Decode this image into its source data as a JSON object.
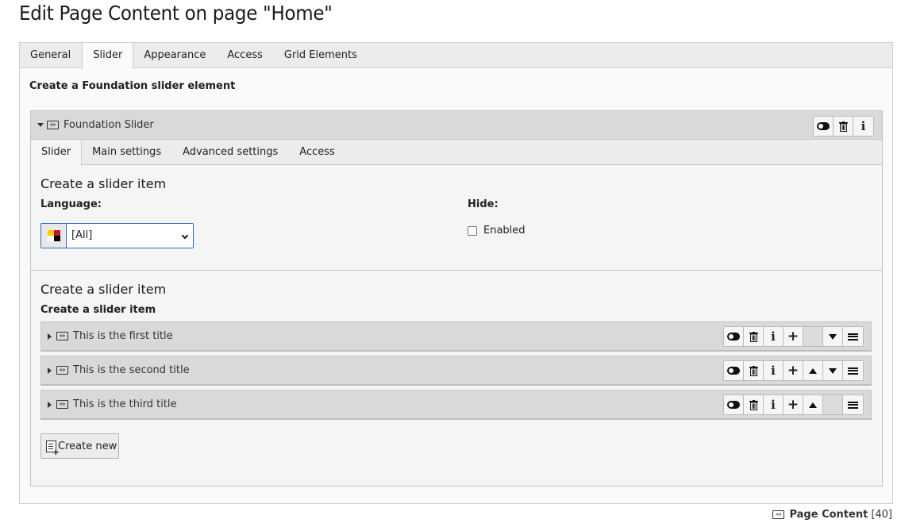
{
  "page_title": "Edit Page Content on page \"Home\"",
  "outer_tabs": [
    "General",
    "Slider",
    "Appearance",
    "Access",
    "Grid Elements"
  ],
  "outer_active_tab": "Slider",
  "section_title": "Create a Foundation slider element",
  "inline_element": {
    "label": "Foundation Slider",
    "tabs": [
      "Slider",
      "Main settings",
      "Advanced settings",
      "Access"
    ],
    "active_tab": "Slider"
  },
  "slider_section": {
    "heading": "Create a slider item",
    "language_label": "Language:",
    "language_value": "[All]",
    "hide_label": "Hide:",
    "enabled_label": "Enabled"
  },
  "items_section": {
    "heading": "Create a slider item",
    "subheading": "Create a slider item",
    "items": [
      {
        "title": "This is the first title"
      },
      {
        "title": "This is the second title"
      },
      {
        "title": "This is the third title"
      }
    ],
    "create_new_label": "Create new"
  },
  "footer": {
    "record_type": "Page Content",
    "record_id": "[40]"
  },
  "icons": {
    "toggle": "toggle-visibility-icon",
    "delete": "trash-icon",
    "info": "info-icon",
    "add": "plus-icon",
    "move_up": "arrow-up-icon",
    "move_down": "arrow-down-icon",
    "drag": "drag-handle-icon",
    "content_element": "content-element-icon",
    "flag": "flag-multilang-icon",
    "create_new": "document-new-icon"
  },
  "colors": {
    "header_bg": "#d9d9d9",
    "tab_bar_bg": "#ececec",
    "focus_border": "#2b6cc4"
  }
}
